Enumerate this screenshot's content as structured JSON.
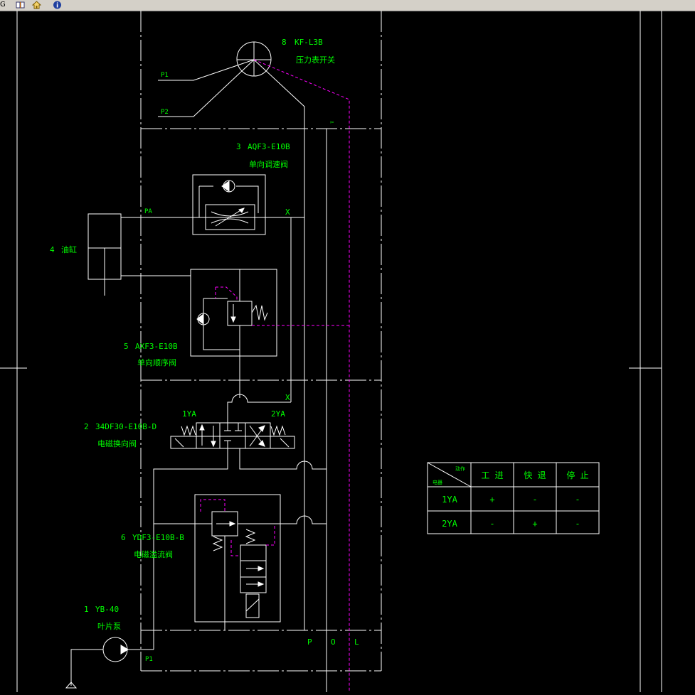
{
  "toolbar": {
    "partial_char": "G",
    "icons": [
      "book-icon",
      "home-icon",
      "info-icon"
    ]
  },
  "colors": {
    "background": "#000000",
    "lines": "#ffffff",
    "labels": "#00ff00",
    "pilot_lines": "#ff00ff"
  },
  "labels": {
    "c8_num": "8",
    "c8_model": "KF-L3B",
    "c8_name": "压力表开关",
    "c3_num": "3",
    "c3_model": "AQF3-E10B",
    "c3_name": "单向调速阀",
    "c4_num": "4",
    "c4_name": "油缸",
    "c5_num": "5",
    "c5_model": "AXF3-E10B",
    "c5_name": "单向顺序阀",
    "c2_num": "2",
    "c2_model": "34DF30-E10B-D",
    "c2_name": "电磁换向阀",
    "c6_num": "6",
    "c6_model": "YDF3-E10B-B",
    "c6_name": "电磁溢流阀",
    "c1_num": "1",
    "c1_model": "YB-40",
    "c1_name": "叶片泵",
    "p1": "P1",
    "p2": "P2",
    "pa": "PA",
    "pump_p": "P1",
    "x1": "X",
    "x2": "X",
    "sym": "✂",
    "sol1": "1YA",
    "sol2": "2YA",
    "port_p": "P",
    "port_o": "O",
    "port_l": "L"
  },
  "table": {
    "corner_top": "动作",
    "corner_bottom": "电器",
    "headers": [
      "工 进",
      "快 退",
      "停 止"
    ],
    "rows": [
      {
        "label": "1YA",
        "cells": [
          "+",
          "-",
          "-"
        ]
      },
      {
        "label": "2YA",
        "cells": [
          "-",
          "+",
          "-"
        ]
      }
    ]
  }
}
